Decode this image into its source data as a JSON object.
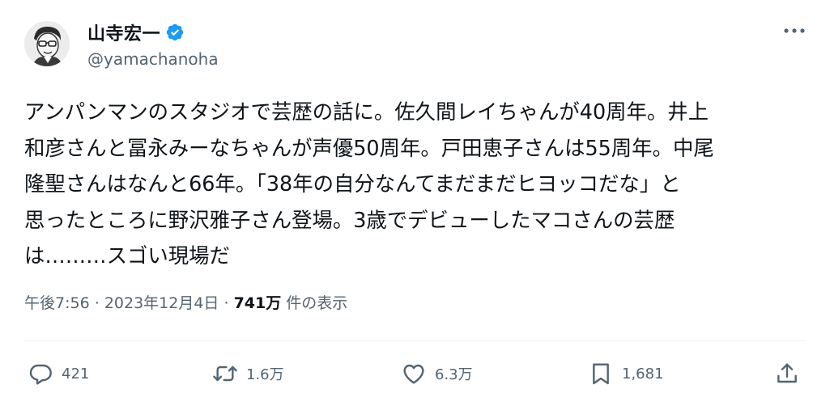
{
  "user": {
    "display_name": "山寺宏一",
    "handle": "@yamachanoha",
    "verified_icon": "verified-badge-icon",
    "badge_color": "#1d9bf0"
  },
  "tweet": {
    "text": "アンパンマンのスタジオで芸歴の話に。佐久間レイちゃんが40周年。井上\n和彦さんと冨永みーなちゃんが声優50周年。戸田恵子さんは55周年。中尾\n隆聖さんはなんと66年。「38年の自分なんてまだまだヒヨッコだな」と\n思ったところに野沢雅子さん登場。3歳でデビューしたマコさんの芸歴\nは………スゴい現場だ",
    "time": "午後7:56",
    "date": "2023年12月4日",
    "separator": "·",
    "views_count": "741万",
    "views_label": "件の表示"
  },
  "actions": {
    "reply_count": "421",
    "retweet_count": "1.6万",
    "like_count": "6.3万",
    "bookmark_count": "1,681"
  },
  "colors": {
    "text": "#0f1419",
    "secondary": "#536471",
    "divider": "#eff3f4"
  }
}
